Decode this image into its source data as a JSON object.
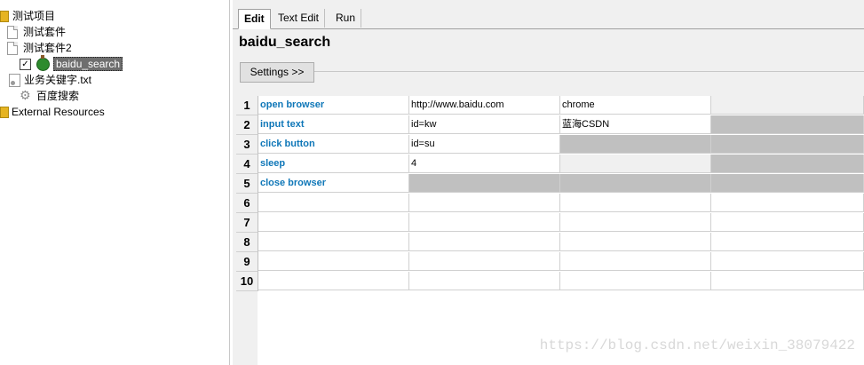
{
  "tree": {
    "items": [
      {
        "label": "测试项目",
        "icon": "folder-icon"
      },
      {
        "label": "测试套件",
        "icon": "document-icon"
      },
      {
        "label": "测试套件2",
        "icon": "document-icon"
      },
      {
        "label": "baidu_search",
        "icon": "robot-icon",
        "checked": true,
        "selected": true
      },
      {
        "label": "业务关键字.txt",
        "icon": "resource-file-icon"
      },
      {
        "label": "百度搜索",
        "icon": "gear-icon"
      },
      {
        "label": "External Resources",
        "icon": "folder-icon"
      }
    ]
  },
  "tabs": [
    {
      "label": "Edit",
      "active": true
    },
    {
      "label": "Text Edit",
      "active": false
    },
    {
      "label": "Run",
      "active": false
    }
  ],
  "editor": {
    "title": "baidu_search",
    "settings_label": "Settings >>"
  },
  "grid": {
    "rows": [
      {
        "num": "1",
        "cells": [
          "open browser",
          "http://www.baidu.com",
          "chrome",
          ""
        ]
      },
      {
        "num": "2",
        "cells": [
          "input text",
          "id=kw",
          "蓝海CSDN",
          ""
        ]
      },
      {
        "num": "3",
        "cells": [
          "click button",
          "id=su",
          "",
          ""
        ]
      },
      {
        "num": "4",
        "cells": [
          "sleep",
          "4",
          "",
          ""
        ]
      },
      {
        "num": "5",
        "cells": [
          "close browser",
          "",
          "",
          ""
        ]
      },
      {
        "num": "6",
        "cells": [
          "",
          "",
          "",
          ""
        ]
      },
      {
        "num": "7",
        "cells": [
          "",
          "",
          "",
          ""
        ]
      },
      {
        "num": "8",
        "cells": [
          "",
          "",
          "",
          ""
        ]
      },
      {
        "num": "9",
        "cells": [
          "",
          "",
          "",
          ""
        ]
      },
      {
        "num": "10",
        "cells": [
          "",
          "",
          "",
          ""
        ]
      }
    ]
  },
  "watermark": "https://blog.csdn.net/weixin_38079422",
  "colors": {
    "keyword": "#0f77b8",
    "disabled_cell": "#c0c0c0",
    "selection": "#6e6e6e"
  }
}
